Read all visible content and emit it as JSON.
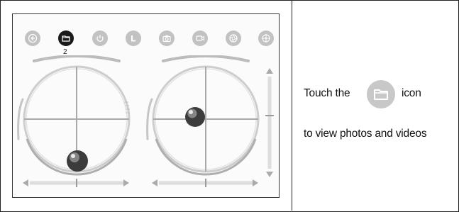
{
  "toolbar": {
    "icons": [
      {
        "name": "back-icon",
        "active": false
      },
      {
        "name": "folder-icon",
        "active": true,
        "badge": "2"
      },
      {
        "name": "power-icon",
        "active": false
      },
      {
        "name": "l-icon",
        "active": false
      },
      {
        "name": "camera-icon",
        "active": false
      },
      {
        "name": "video-icon",
        "active": false
      },
      {
        "name": "aperture-icon",
        "active": false
      },
      {
        "name": "compass-icon",
        "active": false
      }
    ]
  },
  "instructions": {
    "line1_prefix": "Touch the",
    "line1_suffix": "icon",
    "line2": "to view photos and videos",
    "icon": "folder-icon"
  },
  "joysticks": {
    "left": {
      "knob_x": 0.0,
      "knob_y": -0.82
    },
    "right": {
      "knob_x": -0.2,
      "knob_y": 0.0
    }
  },
  "colors": {
    "active_icon": "#1a1a1a",
    "inactive_icon": "#c2c2c2",
    "instruction_icon": "#c8c8c8"
  }
}
